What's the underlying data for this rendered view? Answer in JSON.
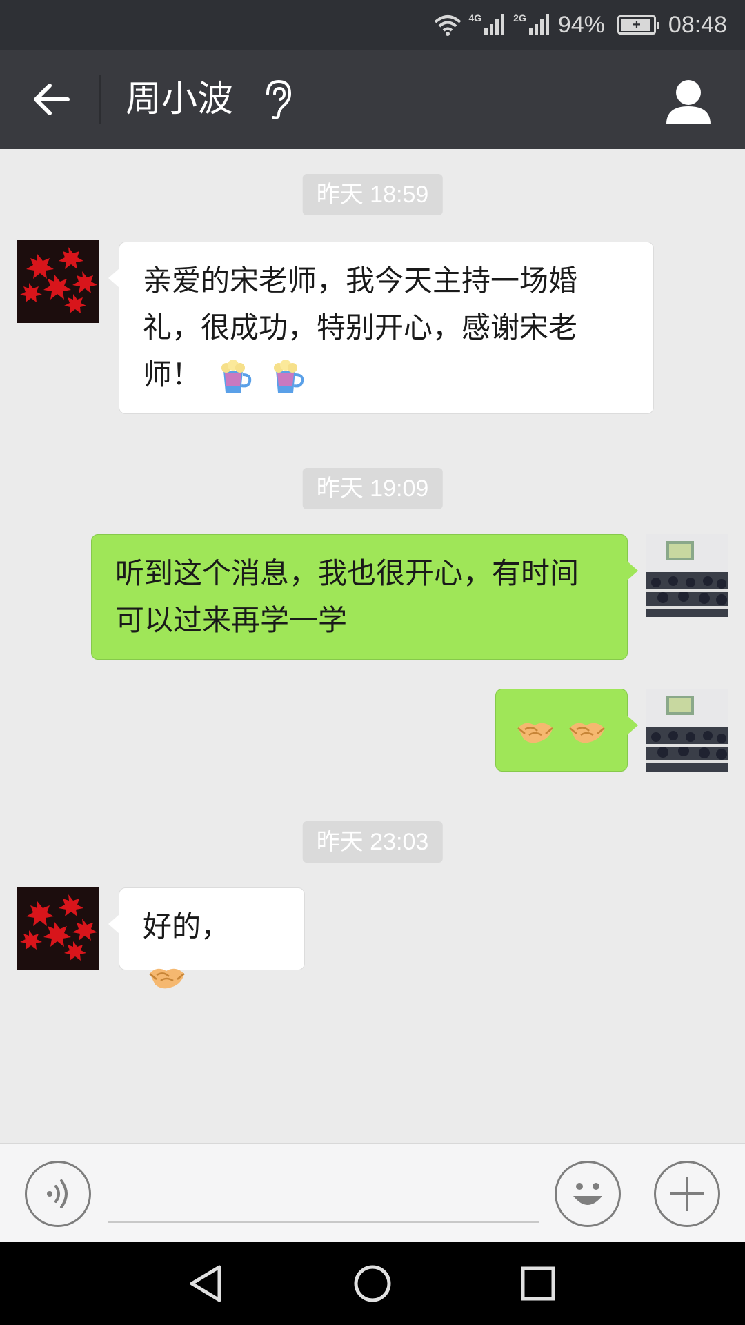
{
  "status_bar": {
    "network_4g": "4G",
    "network_2g": "2G",
    "battery": "94%",
    "battery_level": 0.94,
    "time": "08:48",
    "icons": [
      "wifi-icon",
      "signal-icon",
      "signal-icon",
      "battery-icon"
    ]
  },
  "header": {
    "title": "周小波",
    "back_icon": "arrow-left-icon",
    "mode_icon": "ear-icon",
    "profile_icon": "person-icon"
  },
  "messages": [
    {
      "type": "timestamp",
      "text": "昨天 18:59"
    },
    {
      "type": "incoming",
      "text": "亲爱的宋老师，我今天主持一场婚礼，很成功，特别开心，感谢宋老师！",
      "emoji": [
        "beer-icon",
        "beer-icon"
      ]
    },
    {
      "type": "timestamp",
      "text": "昨天 19:09"
    },
    {
      "type": "outgoing",
      "text": "听到这个消息，我也很开心，有时间可以过来再学一学"
    },
    {
      "type": "outgoing",
      "text": "",
      "emoji": [
        "handshake-icon",
        "handshake-icon"
      ]
    },
    {
      "type": "timestamp",
      "text": "昨天 23:03"
    },
    {
      "type": "incoming",
      "text": "好的，",
      "emoji": [
        "handshake-icon"
      ]
    }
  ],
  "input_bar": {
    "voice_icon": "voice-icon",
    "emoji_icon": "smiley-icon",
    "more_icon": "plus-icon",
    "input_value": ""
  },
  "nav_bar": {
    "icons": [
      "nav-back-icon",
      "nav-home-icon",
      "nav-recents-icon"
    ]
  },
  "colors": {
    "status_bar_bg": "#2e3035",
    "title_bar_bg": "#393a3f",
    "chat_bg": "#ebebeb",
    "outgoing_bubble": "#9fe658",
    "incoming_bubble": "#ffffff",
    "timestamp_bg": "#dadada"
  }
}
